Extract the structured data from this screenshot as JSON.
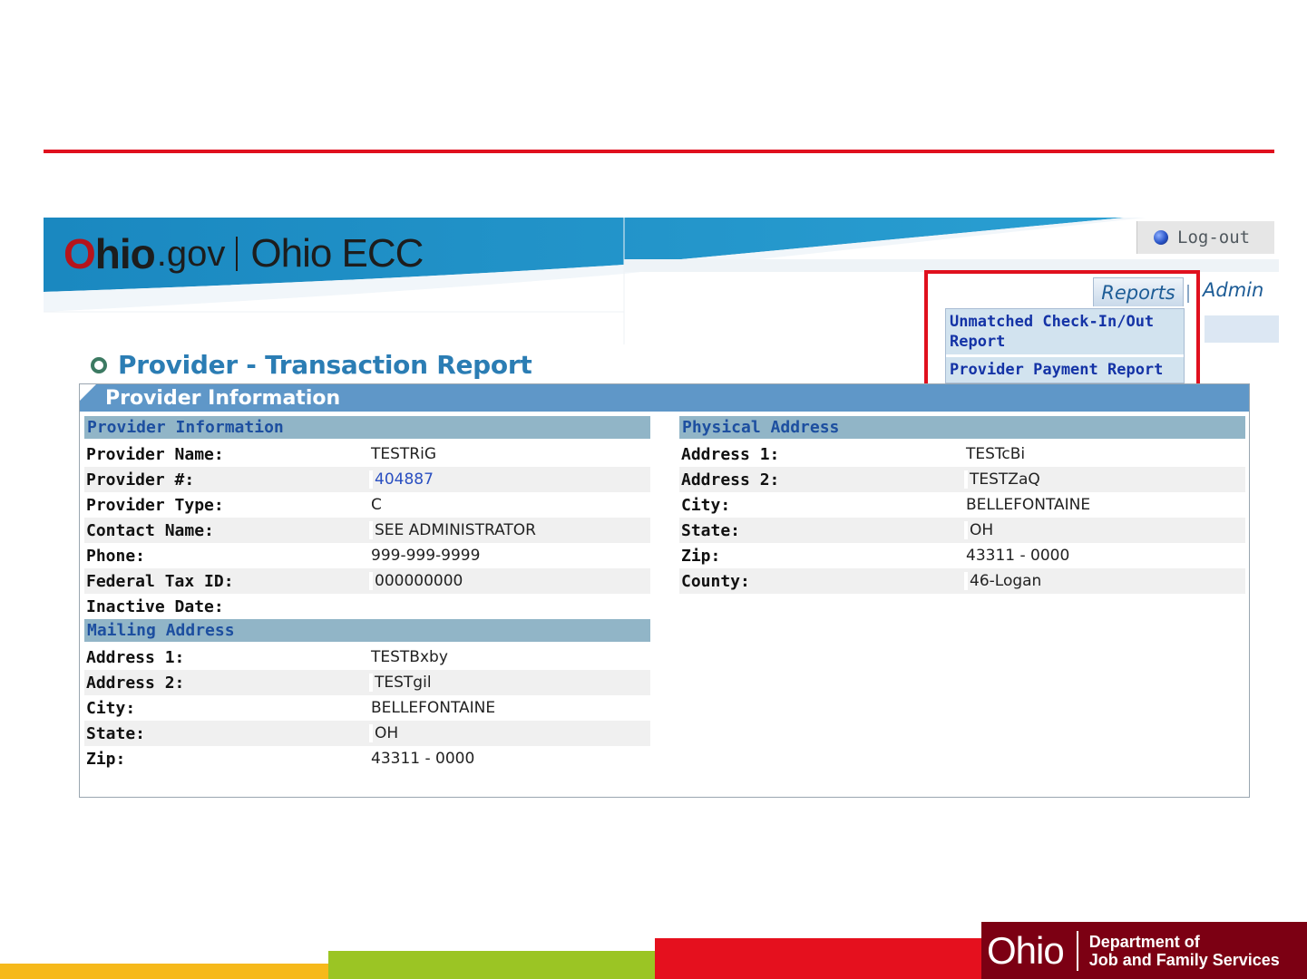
{
  "app": {
    "brand_ohio_o": "O",
    "brand_ohio_rest": "hio",
    "brand_gov": ".gov",
    "brand_app": "Ohio ECC",
    "logout_label": "Log-out"
  },
  "nav": {
    "tabs": [
      {
        "label": "Reports"
      },
      {
        "label": "Admin"
      }
    ],
    "reports_menu": [
      {
        "label": "Unmatched Check-In/Out Report"
      },
      {
        "label": "Provider Payment Report"
      }
    ]
  },
  "page": {
    "title": "Provider - Transaction Report",
    "panel_title": "Provider Information"
  },
  "provider_info": {
    "header": "Provider Information",
    "rows": [
      {
        "label": "Provider Name:",
        "value": "TESTRiG"
      },
      {
        "label": "Provider #:",
        "value": "404887"
      },
      {
        "label": "Provider Type:",
        "value": "C"
      },
      {
        "label": "Contact Name:",
        "value": "SEE ADMINISTRATOR"
      },
      {
        "label": "Phone:",
        "value": "999-999-9999"
      },
      {
        "label": "Federal Tax ID:",
        "value": "000000000"
      },
      {
        "label": "Inactive Date:",
        "value": ""
      }
    ]
  },
  "mailing_address": {
    "header": "Mailing Address",
    "rows": [
      {
        "label": "Address 1:",
        "value": "TESTBxby"
      },
      {
        "label": "Address 2:",
        "value": "TESTgil"
      },
      {
        "label": "City:",
        "value": "BELLEFONTAINE"
      },
      {
        "label": "State:",
        "value": "OH"
      },
      {
        "label": "Zip:",
        "value": "43311 - 0000"
      }
    ]
  },
  "physical_address": {
    "header": "Physical Address",
    "rows": [
      {
        "label": "Address 1:",
        "value": "TESTcBi"
      },
      {
        "label": "Address 2:",
        "value": "TESTZaQ"
      },
      {
        "label": "City:",
        "value": "BELLEFONTAINE"
      },
      {
        "label": "State:",
        "value": "OH"
      },
      {
        "label": "Zip:",
        "value": "43311 - 0000"
      },
      {
        "label": "County:",
        "value": "46-Logan"
      }
    ]
  },
  "footer": {
    "logo_word": "Ohio",
    "dept_line1": "Department of",
    "dept_line2": "Job and Family Services"
  },
  "colors": {
    "accent_red": "#e0101e",
    "banner_blue": "#2591c4",
    "title_blue": "#2b7db4",
    "panel_header_blue": "#5f97c8",
    "section_header": "#91b5c7",
    "footer_maroon": "#7c0013"
  },
  "icons": {
    "logout": "globe-dot-icon",
    "title_bullet": "circle-bullet-icon"
  }
}
